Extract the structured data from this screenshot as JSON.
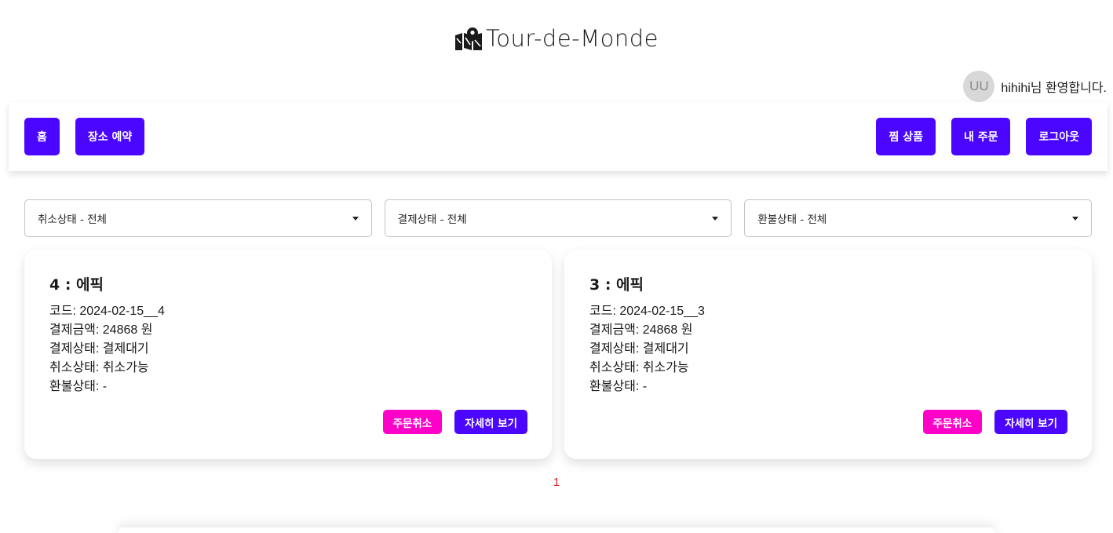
{
  "brand": {
    "title": "Tour-de-Monde",
    "icon": "map-location-icon"
  },
  "user": {
    "avatar_text": "UU",
    "welcome": "hihihi님 환영합니다."
  },
  "nav": {
    "left": [
      {
        "label": "홈"
      },
      {
        "label": "장소 예약"
      }
    ],
    "right": [
      {
        "label": "찜 상품"
      },
      {
        "label": "내 주문"
      },
      {
        "label": "로그아웃"
      }
    ]
  },
  "filters": [
    {
      "label": "취소상태 - 전체"
    },
    {
      "label": "결제상태 - 전체"
    },
    {
      "label": "환불상태 - 전체"
    }
  ],
  "orders": [
    {
      "title": "4 : 에픽",
      "code": "코드: 2024-02-15__4",
      "amount": "결제금액: 24868 원",
      "payment": "결제상태: 결제대기",
      "cancel": "취소상태: 취소가능",
      "refund": "환불상태: -",
      "cancel_label": "주문취소",
      "detail_label": "자세히 보기"
    },
    {
      "title": "3 : 에픽",
      "code": "코드: 2024-02-15__3",
      "amount": "결제금액: 24868 원",
      "payment": "결제상태: 결제대기",
      "cancel": "취소상태: 취소가능",
      "refund": "환불상태: -",
      "cancel_label": "주문취소",
      "detail_label": "자세히 보기"
    }
  ],
  "pagination": {
    "current": "1"
  },
  "colors": {
    "primary": "#4a06ff",
    "danger": "#ff00c8",
    "page": "#e0202a"
  }
}
